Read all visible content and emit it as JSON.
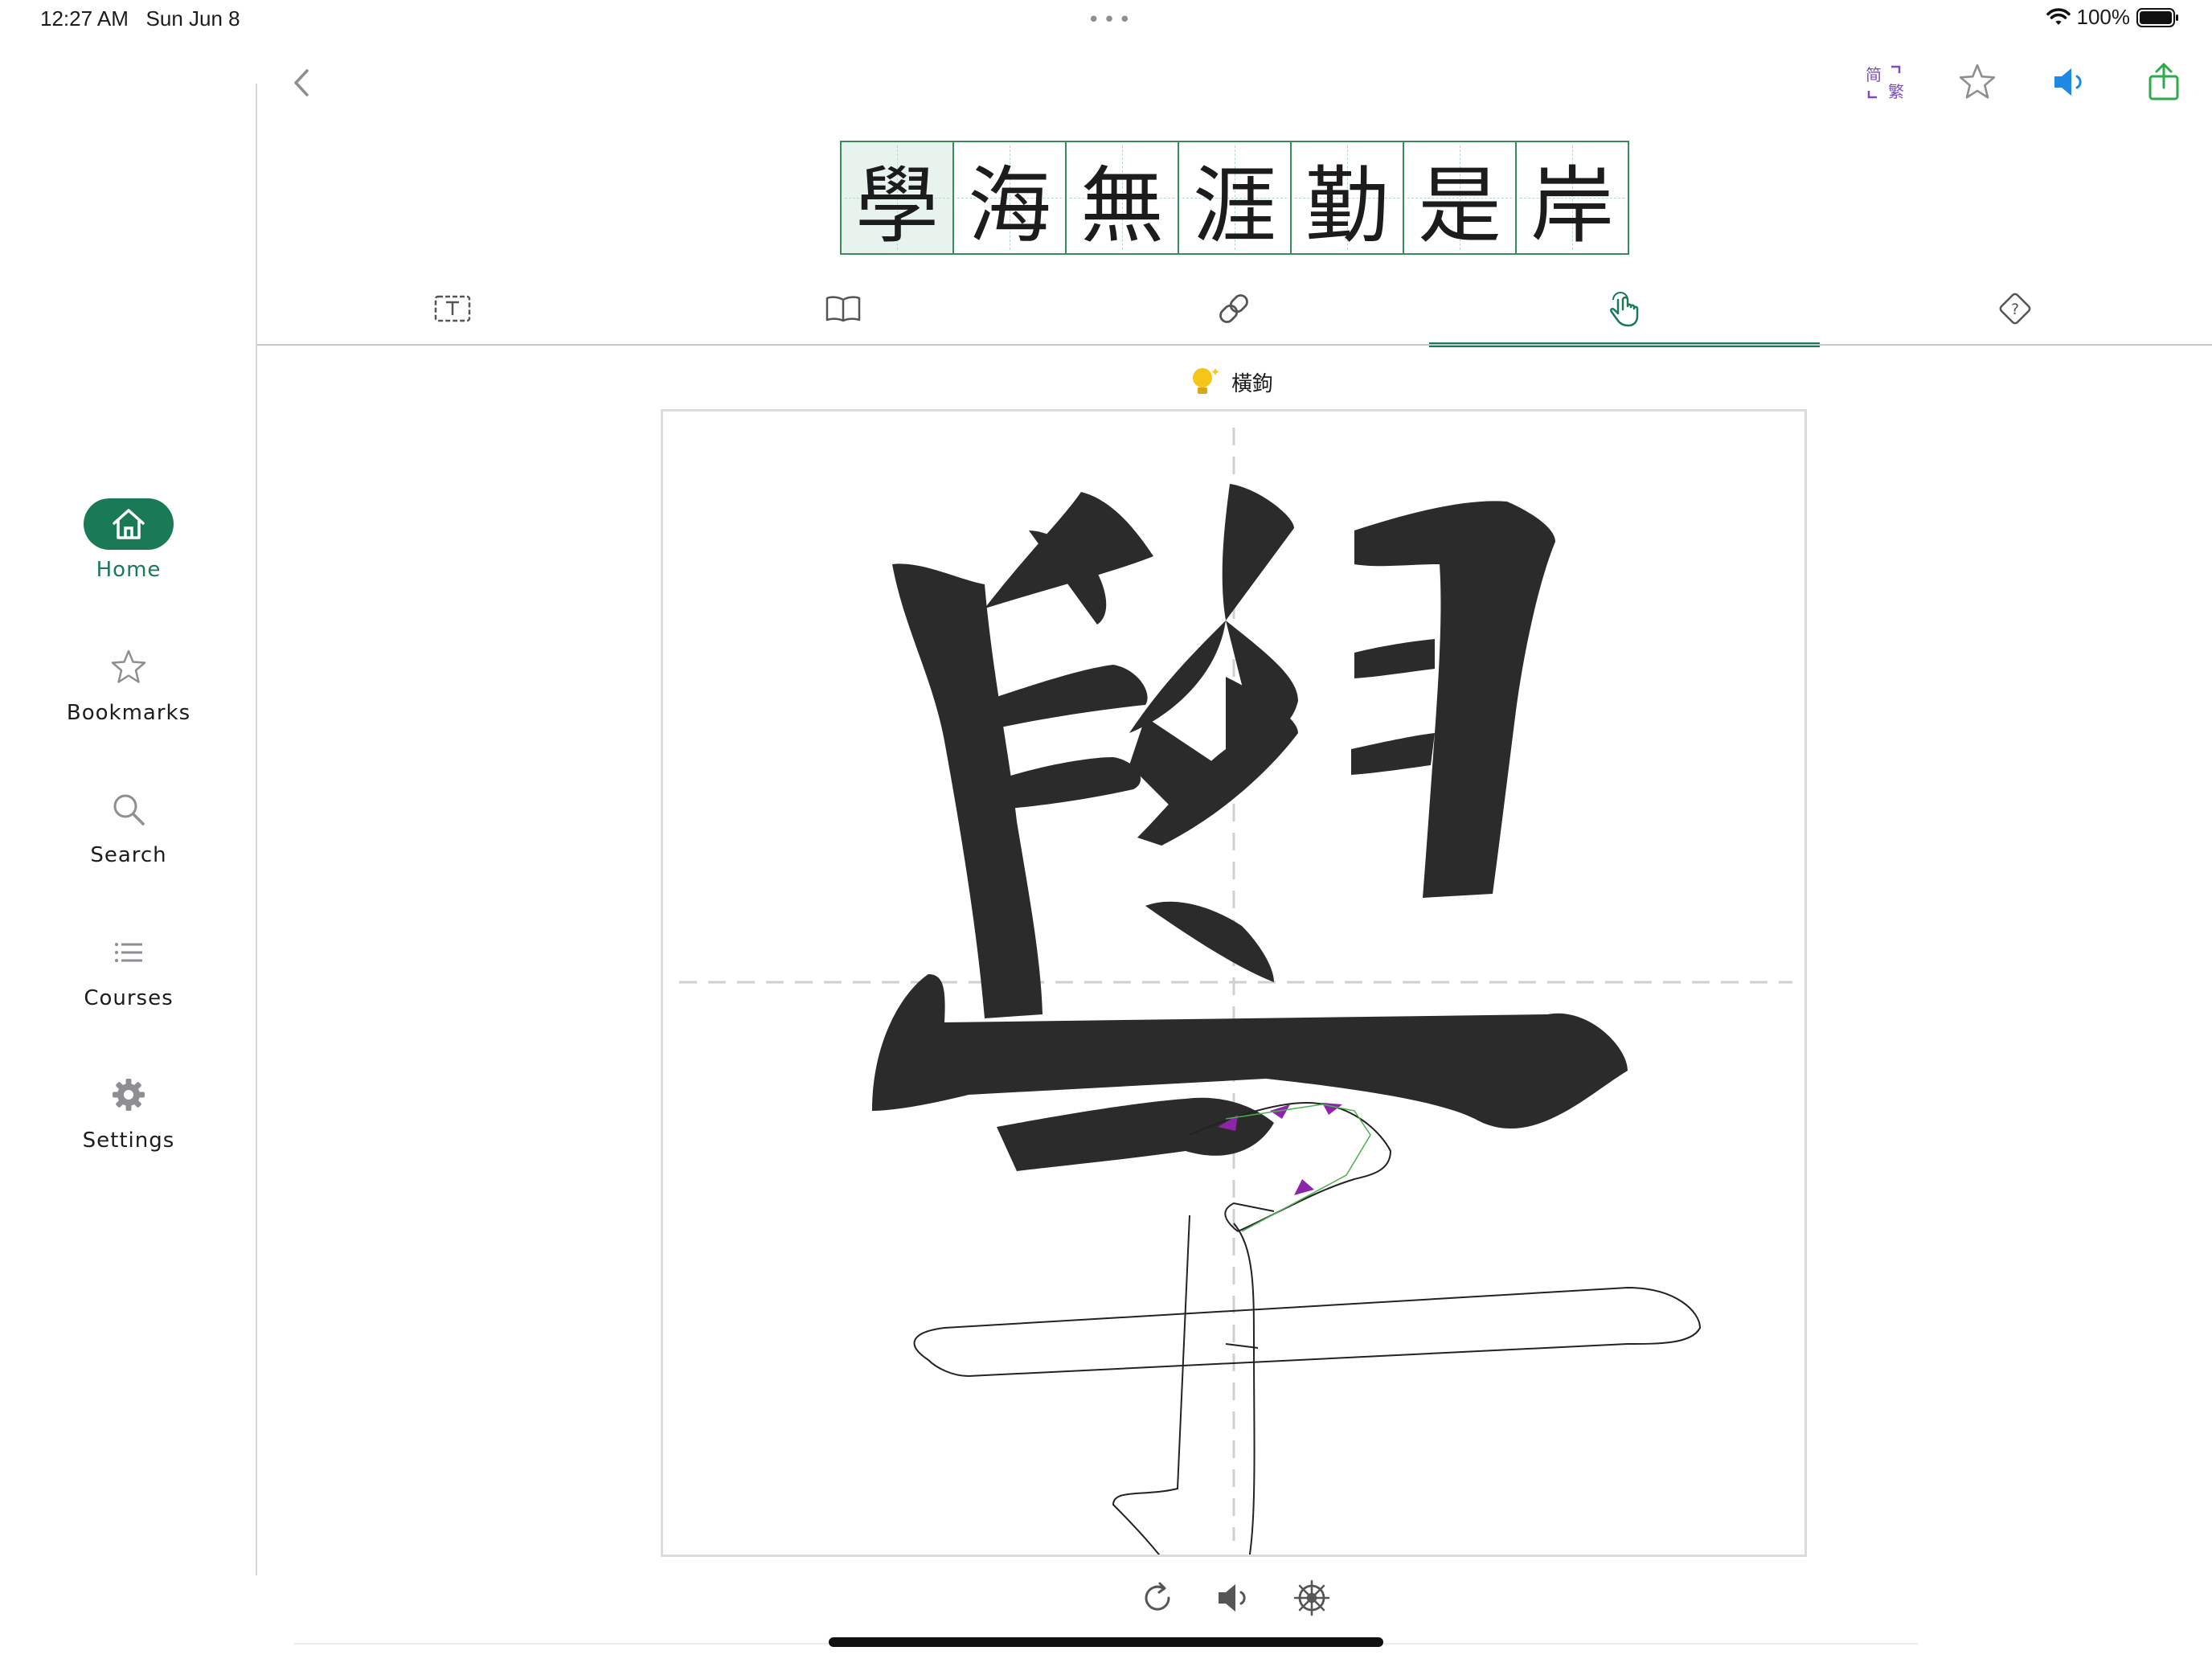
{
  "status_bar": {
    "time": "12:27 AM",
    "date": "Sun Jun 8",
    "battery": "100%"
  },
  "sidebar": {
    "items": [
      {
        "label": "Home",
        "icon": "home-icon",
        "active": true
      },
      {
        "label": "Bookmarks",
        "icon": "star-icon",
        "active": false
      },
      {
        "label": "Search",
        "icon": "search-icon",
        "active": false
      },
      {
        "label": "Courses",
        "icon": "list-icon",
        "active": false
      },
      {
        "label": "Settings",
        "icon": "gear-icon",
        "active": false
      }
    ]
  },
  "toolbar": {
    "script_toggle_simplified": "简",
    "script_toggle_traditional": "繁",
    "icons": [
      "chevron-left-icon",
      "script-toggle-icon",
      "star-icon",
      "speaker-icon",
      "share-icon"
    ]
  },
  "phrase": {
    "characters": [
      "學",
      "海",
      "無",
      "涯",
      "勤",
      "是",
      "岸"
    ],
    "selected_index": 0
  },
  "tabs": [
    {
      "icon": "text-box-icon",
      "active": false
    },
    {
      "icon": "book-icon",
      "active": false
    },
    {
      "icon": "link-icon",
      "active": false
    },
    {
      "icon": "hand-pointer-icon",
      "active": true
    },
    {
      "icon": "question-diamond-icon",
      "active": false
    }
  ],
  "stroke_hint": {
    "icon": "lightbulb-icon",
    "stroke_name": "橫鉤"
  },
  "controls": {
    "icons": [
      "redo-icon",
      "speaker-icon",
      "settings-wheel-icon"
    ]
  },
  "colors": {
    "accent": "#1b7a56",
    "tile_border": "#3a8a5e",
    "stroke_fill": "#2b2b2b",
    "arrow": "#8e24aa",
    "speaker_blue": "#1e88e5",
    "share_green": "#2eaa4a",
    "toggle_purple": "#7b4cc4",
    "bulb_yellow": "#f5c518"
  }
}
